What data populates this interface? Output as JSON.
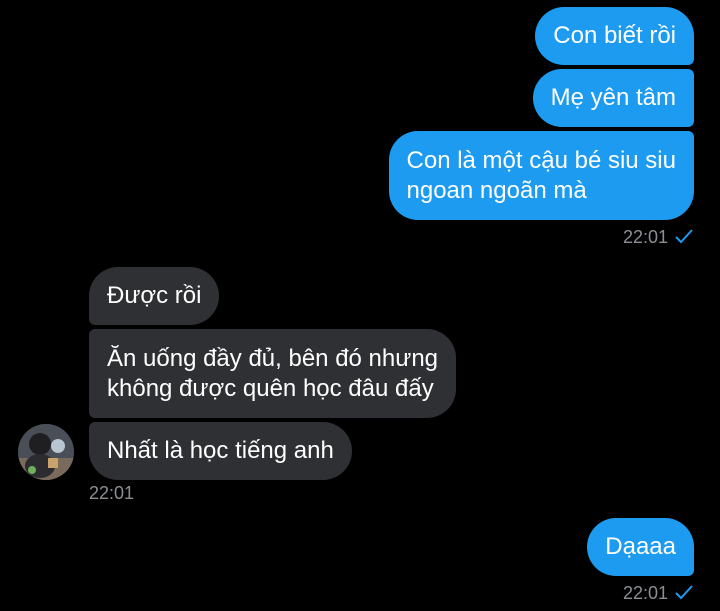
{
  "conversation": {
    "outgoing_group1": [
      {
        "text": "Con biết rồi"
      },
      {
        "text": "Mẹ yên tâm"
      },
      {
        "lines": [
          "Con là một cậu bé siu siu",
          "ngoan ngoãn mà"
        ]
      }
    ],
    "outgoing_group1_time": "22:01",
    "incoming_group": [
      {
        "text": "Được rồi"
      },
      {
        "lines": [
          "Ăn uống đầy đủ, bên đó nhưng",
          "không được quên học đâu đấy"
        ]
      },
      {
        "text": "Nhất là học tiếng anh"
      }
    ],
    "incoming_group_time": "22:01",
    "outgoing_group2": [
      {
        "text": "Dạaaa"
      }
    ],
    "outgoing_group2_time": "22:01"
  },
  "colors": {
    "background": "#000000",
    "outgoing_bubble": "#1d9bf0",
    "incoming_bubble": "#2f3033",
    "timestamp": "#8b8f94",
    "read_check": "#1d9bf0"
  },
  "icons": {
    "read_receipt": "checkmark-icon",
    "avatar": "user-avatar"
  }
}
